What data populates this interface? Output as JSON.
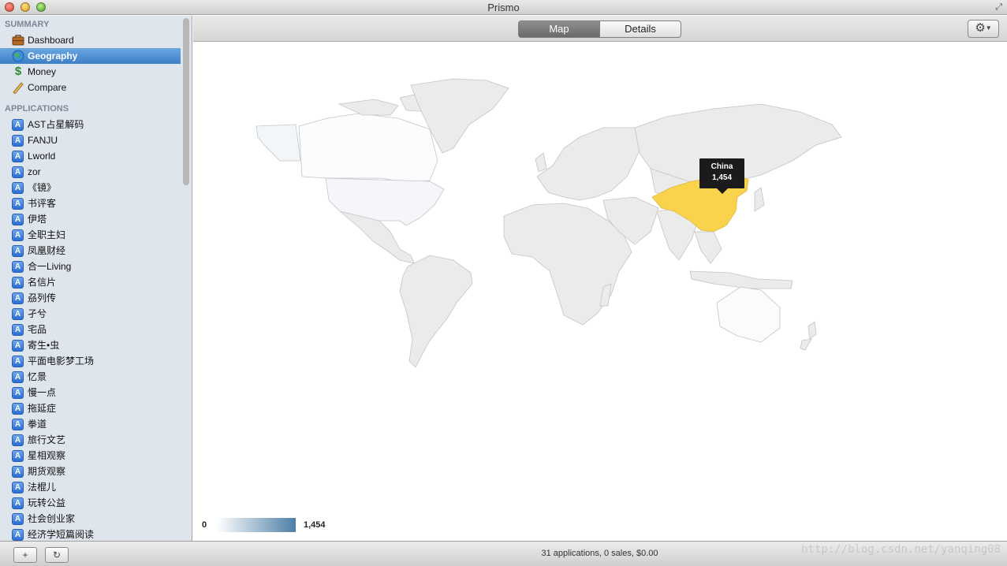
{
  "window": {
    "title": "Prismo"
  },
  "sidebar": {
    "summary_header": "SUMMARY",
    "summary_items": [
      {
        "label": "Dashboard",
        "icon": "briefcase-icon"
      },
      {
        "label": "Geography",
        "icon": "globe-icon",
        "selected": true
      },
      {
        "label": "Money",
        "icon": "dollar-icon"
      },
      {
        "label": "Compare",
        "icon": "ruler-icon"
      }
    ],
    "applications_header": "APPLICATIONS",
    "applications": [
      "AST占星解码",
      "FANJU",
      "Lworld",
      "zor",
      "《镜》",
      "书评客",
      "伊塔",
      "全职主妇",
      "凤凰财经",
      "合一Living",
      "名信片",
      "刕列传",
      "孑兮",
      "宅品",
      "寄生•虫",
      "平面电影梦工场",
      "忆景",
      "慢一点",
      "拖延症",
      "拳道",
      "旅行文艺",
      "星相观察",
      "期货观察",
      "法棍儿",
      "玩转公益",
      "社会创业家",
      "经济学短篇阅读"
    ]
  },
  "toolbar": {
    "tabs": [
      {
        "label": "Map",
        "selected": true
      },
      {
        "label": "Details",
        "selected": false
      }
    ],
    "gear_icon": "gear-icon"
  },
  "map": {
    "tooltip_country": "China",
    "tooltip_value": "1,454",
    "highlight_color": "#f9d34c",
    "base_color": "#ebebeb",
    "legend_min": "0",
    "legend_max": "1,454",
    "legend_colors": [
      "#ffffff",
      "#4d7fa6"
    ]
  },
  "statusbar": {
    "text": "31 applications, 0 sales, $0.00",
    "add_label": "+",
    "refresh_icon": "refresh-icon",
    "watermark": "http://blog.csdn.net/yanqing08"
  }
}
